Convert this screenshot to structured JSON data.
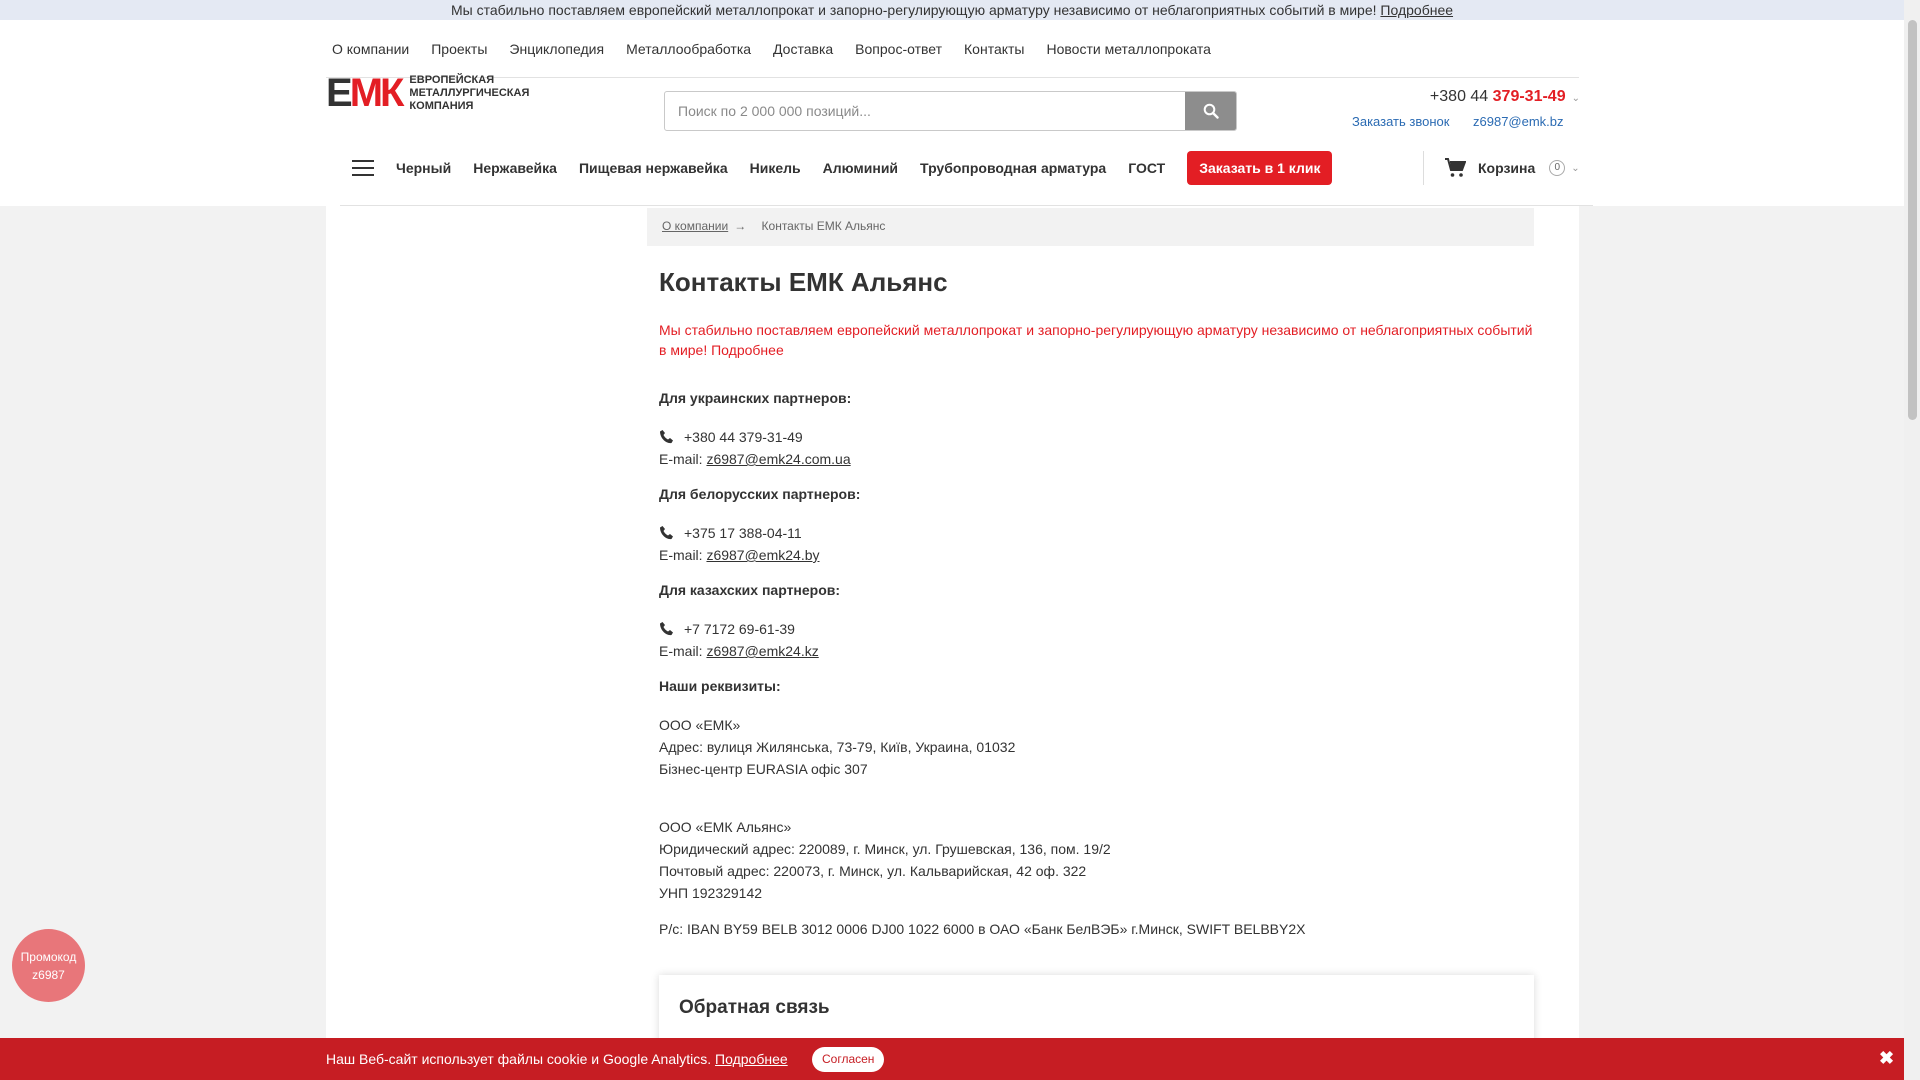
{
  "notice_bar": {
    "text": "Мы стабильно поставляем европейский металлопрокат и запорно-регулирующую арматуру независимо от неблагоприятных событий в мире!",
    "link": "Подробнее"
  },
  "top_nav": [
    "О компании",
    "Проекты",
    "Энциклопедия",
    "Металлообработка",
    "Доставка",
    "Вопрос-ответ",
    "Контакты",
    "Новости металлопроката"
  ],
  "logo": {
    "mark_e": "Е",
    "mark_mk": "МК",
    "line1": "Европейская",
    "line2": "металлургическая",
    "line3": "компания"
  },
  "search": {
    "placeholder": "Поиск по 2 000 000 позиций..."
  },
  "header_contacts": {
    "phone_prefix": "+380 44",
    "phone_main": "379-31-49",
    "callback": "Заказать звонок",
    "email": "z6987@emk.bz"
  },
  "category_nav": [
    "Черный",
    "Нержавейка",
    "Пищевая нержавейка",
    "Никель",
    "Алюминий",
    "Трубопроводная арматура",
    "ГОСТ"
  ],
  "one_click": "Заказать в 1 клик",
  "cart": {
    "label": "Корзина",
    "count": "0"
  },
  "breadcrumbs": {
    "parent": "О компании",
    "arrow": "→",
    "current": "Контакты ЕМК Альянс"
  },
  "page": {
    "title": "Контакты ЕМК Альянс",
    "notice": "Мы стабильно поставляем европейский металлопрокат и запорно-регулирующую арматуру независимо от неблагоприятных событий в мире! Подробнее",
    "ua": {
      "heading": "Для украинских партнеров:",
      "phone": "+380 44 379-31-49",
      "email_label": "E-mail:",
      "email": "z6987@emk24.com.ua"
    },
    "by": {
      "heading": "Для белорусских партнеров:",
      "phone": "+375 17 388-04-11",
      "email_label": "E-mail:",
      "email": "z6987@emk24.by"
    },
    "kz": {
      "heading": "Для казахских партнеров:",
      "phone": "+7 7172 69-61-39",
      "email_label": "E-mail:",
      "email": "z6987@emk24.kz"
    },
    "requisites_heading": "Наши реквизиты:",
    "company1": {
      "name": "ООО «ЕМК»",
      "address": "Адрес: вулиця Жилянська, 73-79, Київ, Украина, 01032",
      "office": "Бізнес-центр EURASIA офіс 307"
    },
    "company2": {
      "name": "ООО «ЕМК Альянс»",
      "legal": "Юридический адрес: 220089, г. Минск, ул. Грушевская, 136, пом. 19/2",
      "postal": "Почтовый адрес: 220073, г. Минск, ул. Кальварийская, 42 оф. 322",
      "unp": "УНП 192329142",
      "account": "Р/с: IBAN BY59 BELB 3012 0006 DJ00 1022 6000 в ОАО «Банк БелВЭБ» г.Минск, SWIFT BELBBY2X"
    }
  },
  "feedback": {
    "title": "Обратная связь"
  },
  "promo": {
    "line1": "Промокод",
    "line2": "z6987"
  },
  "cookie": {
    "text": "Наш Веб-сайт использует файлы cookie и Google Analytics.",
    "link": "Подробнее",
    "agree": "Согласен",
    "close": "✖"
  },
  "colors": {
    "accent": "#e31e24",
    "link": "#2b6bb3",
    "cookie_bar": "#c61d23",
    "promo": "#e8767a"
  }
}
